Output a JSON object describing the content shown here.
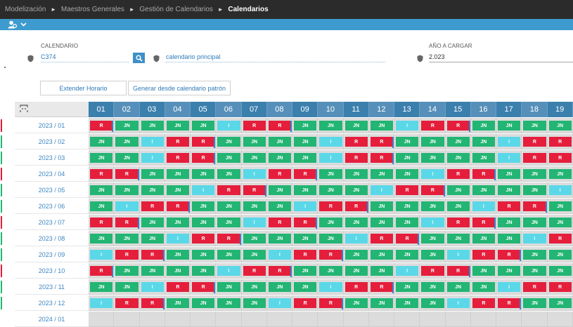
{
  "breadcrumb": {
    "items": [
      "Modelización",
      "Maestros Generales",
      "Gestión de Calendarios"
    ],
    "current": "Calendarios",
    "separator": "►"
  },
  "toolbar": {
    "menu_icon": "user-gear-icon",
    "dropdown_icon": "chevron-down-icon"
  },
  "form": {
    "calendario_label": "CALENDARIO",
    "calendario_code": "C374",
    "calendario_desc": "calendario principal",
    "anio_label": "AÑO A CARGAR",
    "anio_value": "2.023"
  },
  "buttons": {
    "extender": "Extender Horario",
    "generar": "Generar desde calendario patrón"
  },
  "colors": {
    "JN": "#22b573",
    "R": "#e51e3c",
    "I": "#5ad8e8",
    "header": "#3b7fad",
    "accent": "#3e9bcf"
  },
  "grid": {
    "days": [
      "01",
      "02",
      "03",
      "04",
      "05",
      "06",
      "07",
      "08",
      "09",
      "10",
      "11",
      "12",
      "13",
      "14",
      "15",
      "16",
      "17",
      "18",
      "19"
    ],
    "legend_codes": {
      "JN": "JN",
      "R": "R",
      "I": "I"
    },
    "months": [
      {
        "label": "2023 / 01",
        "cells": [
          "R",
          "JN",
          "JN",
          "JN",
          "JN",
          "I",
          "R",
          "R",
          "JN",
          "JN",
          "JN",
          "JN",
          "I",
          "R",
          "R",
          "JN",
          "JN",
          "JN",
          "JN"
        ]
      },
      {
        "label": "2023 / 02",
        "cells": [
          "JN",
          "JN",
          "I",
          "R",
          "R",
          "JN",
          "JN",
          "JN",
          "JN",
          "I",
          "R",
          "R",
          "JN",
          "JN",
          "JN",
          "JN",
          "I",
          "R",
          "R"
        ]
      },
      {
        "label": "2023 / 03",
        "cells": [
          "JN",
          "JN",
          "I",
          "R",
          "R",
          "JN",
          "JN",
          "JN",
          "JN",
          "I",
          "R",
          "R",
          "JN",
          "JN",
          "JN",
          "JN",
          "I",
          "R",
          "R"
        ]
      },
      {
        "label": "2023 / 04",
        "cells": [
          "R",
          "R",
          "JN",
          "JN",
          "JN",
          "JN",
          "I",
          "R",
          "R",
          "JN",
          "JN",
          "JN",
          "JN",
          "I",
          "R",
          "R",
          "JN",
          "JN",
          "JN"
        ]
      },
      {
        "label": "2023 / 05",
        "cells": [
          "JN",
          "JN",
          "JN",
          "JN",
          "I",
          "R",
          "R",
          "JN",
          "JN",
          "JN",
          "JN",
          "I",
          "R",
          "R",
          "JN",
          "JN",
          "JN",
          "JN",
          "I"
        ]
      },
      {
        "label": "2023 / 06",
        "cells": [
          "JN",
          "I",
          "R",
          "R",
          "JN",
          "JN",
          "JN",
          "JN",
          "I",
          "R",
          "R",
          "JN",
          "JN",
          "JN",
          "JN",
          "I",
          "R",
          "R",
          "JN"
        ]
      },
      {
        "label": "2023 / 07",
        "cells": [
          "R",
          "R",
          "JN",
          "JN",
          "JN",
          "JN",
          "I",
          "R",
          "R",
          "JN",
          "JN",
          "JN",
          "JN",
          "I",
          "R",
          "R",
          "JN",
          "JN",
          "JN"
        ]
      },
      {
        "label": "2023 / 08",
        "cells": [
          "JN",
          "JN",
          "JN",
          "I",
          "R",
          "R",
          "JN",
          "JN",
          "JN",
          "JN",
          "I",
          "R",
          "R",
          "JN",
          "JN",
          "JN",
          "JN",
          "I",
          "R"
        ]
      },
      {
        "label": "2023 / 09",
        "cells": [
          "I",
          "R",
          "R",
          "JN",
          "JN",
          "JN",
          "JN",
          "I",
          "R",
          "R",
          "JN",
          "JN",
          "JN",
          "JN",
          "I",
          "R",
          "R",
          "JN",
          "JN"
        ]
      },
      {
        "label": "2023 / 10",
        "cells": [
          "R",
          "JN",
          "JN",
          "JN",
          "JN",
          "I",
          "R",
          "R",
          "JN",
          "JN",
          "JN",
          "JN",
          "I",
          "R",
          "R",
          "JN",
          "JN",
          "JN",
          "JN"
        ]
      },
      {
        "label": "2023 / 11",
        "cells": [
          "JN",
          "JN",
          "I",
          "R",
          "R",
          "JN",
          "JN",
          "JN",
          "JN",
          "I",
          "R",
          "R",
          "JN",
          "JN",
          "JN",
          "JN",
          "I",
          "R",
          "R"
        ]
      },
      {
        "label": "2023 / 12",
        "cells": [
          "I",
          "R",
          "R",
          "JN",
          "JN",
          "JN",
          "JN",
          "I",
          "R",
          "R",
          "JN",
          "JN",
          "JN",
          "JN",
          "I",
          "R",
          "R",
          "JN",
          "JN"
        ]
      },
      {
        "label": "2024 / 01",
        "cells": []
      }
    ]
  }
}
